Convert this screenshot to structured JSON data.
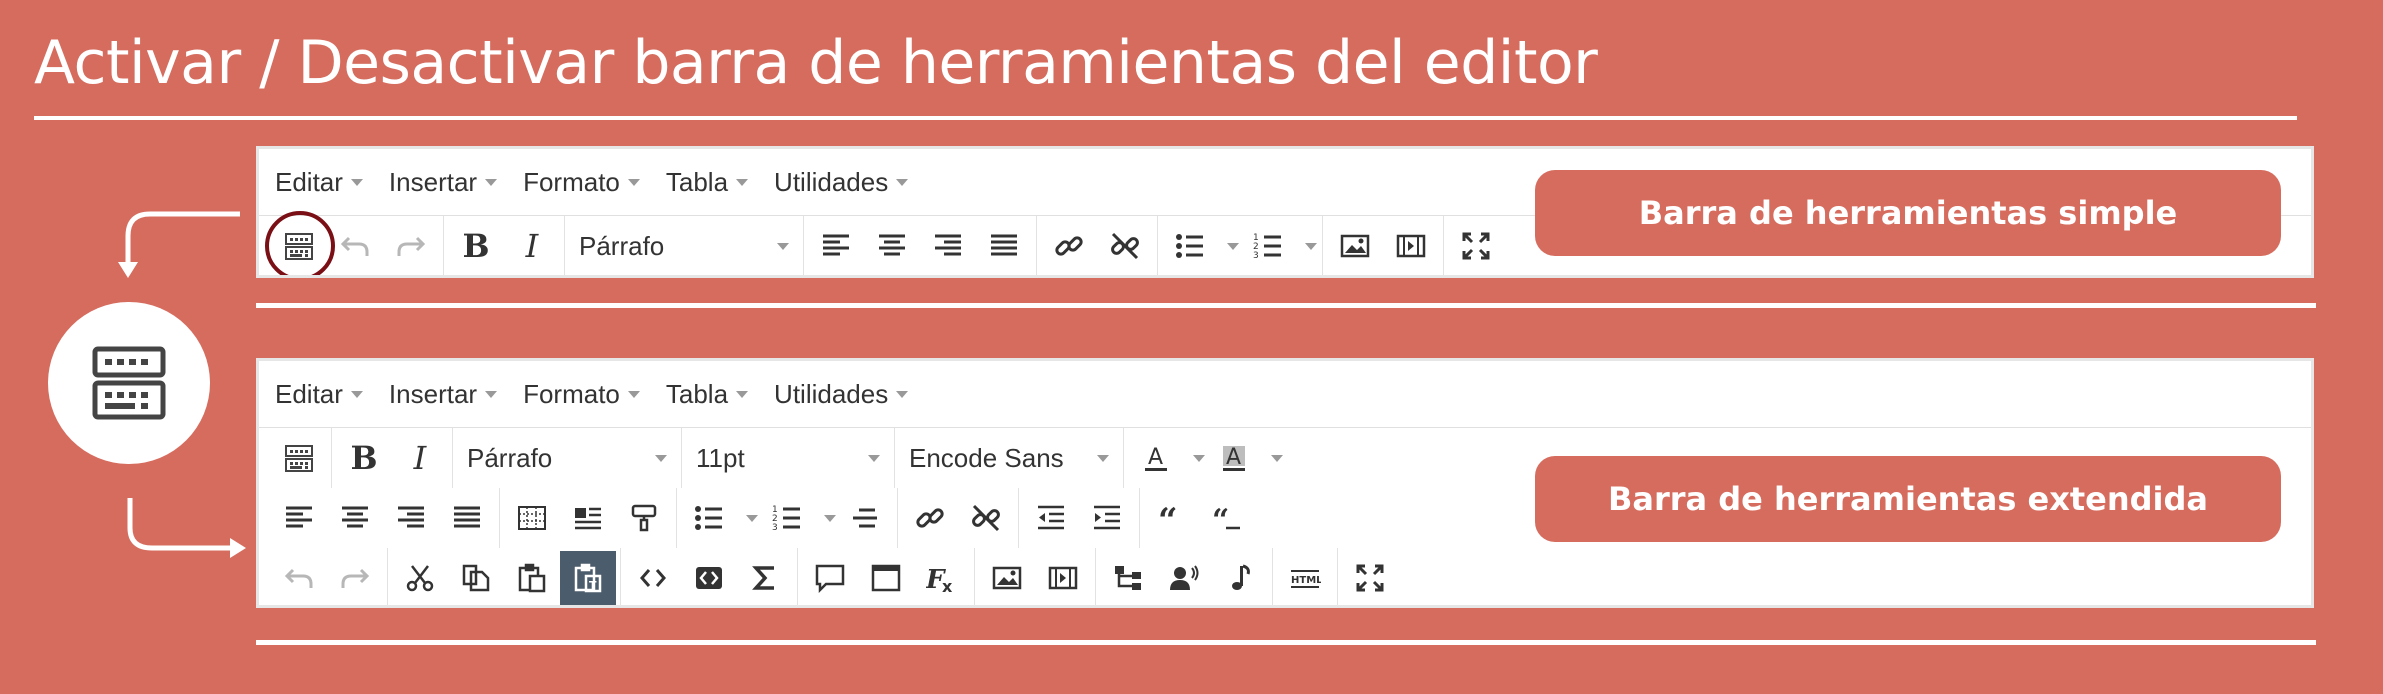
{
  "title": "Activar / Desactivar barra de herramientas del editor",
  "menu": [
    {
      "label": "Editar"
    },
    {
      "label": "Insertar"
    },
    {
      "label": "Formato"
    },
    {
      "label": "Tabla"
    },
    {
      "label": "Utilidades"
    }
  ],
  "simple": {
    "paragraph_select": "Párrafo",
    "callout": "Barra de herramientas simple",
    "toggle_highlighted": true
  },
  "extended": {
    "paragraph_select": "Párrafo",
    "font_size_select": "11pt",
    "font_family_select": "Encode Sans",
    "callout": "Barra de herramientas extendida",
    "active_button": "paste-text-icon"
  },
  "html_button_label": "HTML",
  "colors": {
    "background": "#d66c5e",
    "highlight_ring": "#7a1016",
    "active_button_bg": "#4b5c6c"
  }
}
